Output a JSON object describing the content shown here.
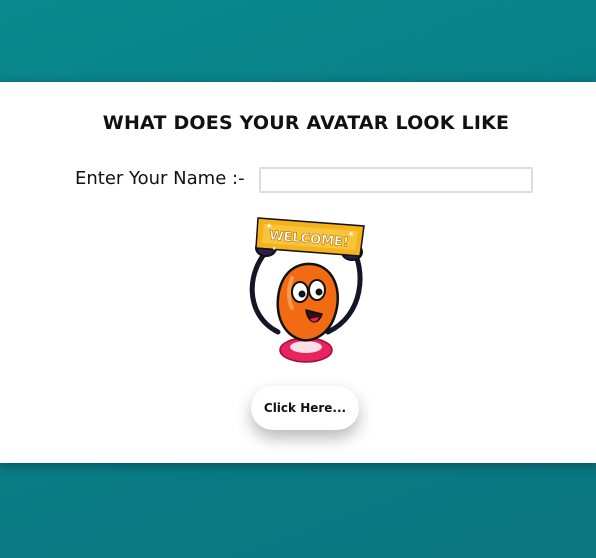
{
  "header": {
    "title": "WHAT DOES YOUR AVATAR LOOK LIKE"
  },
  "form": {
    "name_label": "Enter Your Name :-",
    "name_value": "",
    "name_placeholder": ""
  },
  "avatar": {
    "banner_text": "WELCOME!",
    "colors": {
      "banner": "#f6b21b",
      "body": "#f26a12",
      "outline": "#111111",
      "base": "#e8245e"
    }
  },
  "actions": {
    "submit_label": "Click Here..."
  },
  "theme": {
    "background": "#0a8a8e",
    "panel": "#ffffff"
  }
}
